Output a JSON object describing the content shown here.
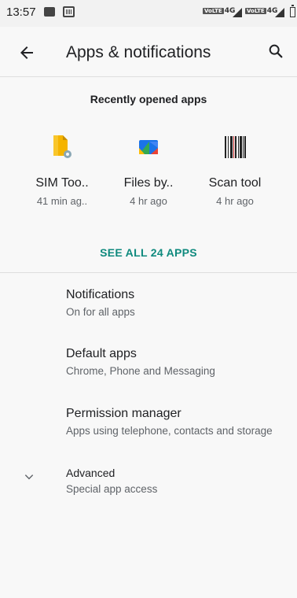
{
  "status_bar": {
    "time": "13:57",
    "network1": "4G",
    "network2": "4G",
    "volte1": "VoLTE",
    "volte2": "VoLTE"
  },
  "toolbar": {
    "title": "Apps & notifications",
    "back_icon": "arrow-back-icon",
    "search_icon": "search-icon"
  },
  "recent": {
    "heading": "Recently opened apps",
    "apps": [
      {
        "name": "SIM Too..",
        "time": "41 min ag..",
        "icon": "sim-toolkit-icon"
      },
      {
        "name": "Files by..",
        "time": "4 hr ago",
        "icon": "files-icon"
      },
      {
        "name": "Scan tool",
        "time": "4 hr ago",
        "icon": "barcode-icon"
      }
    ],
    "see_all": "SEE ALL 24 APPS"
  },
  "settings": [
    {
      "label": "Notifications",
      "sub": "On for all apps"
    },
    {
      "label": "Default apps",
      "sub": "Chrome, Phone and Messaging"
    },
    {
      "label": "Permission manager",
      "sub": "Apps using telephone, contacts and storage"
    },
    {
      "label": "Advanced",
      "sub": "Special app access"
    }
  ],
  "colors": {
    "accent": "#0f8a7e",
    "background": "#f8f8f8"
  }
}
